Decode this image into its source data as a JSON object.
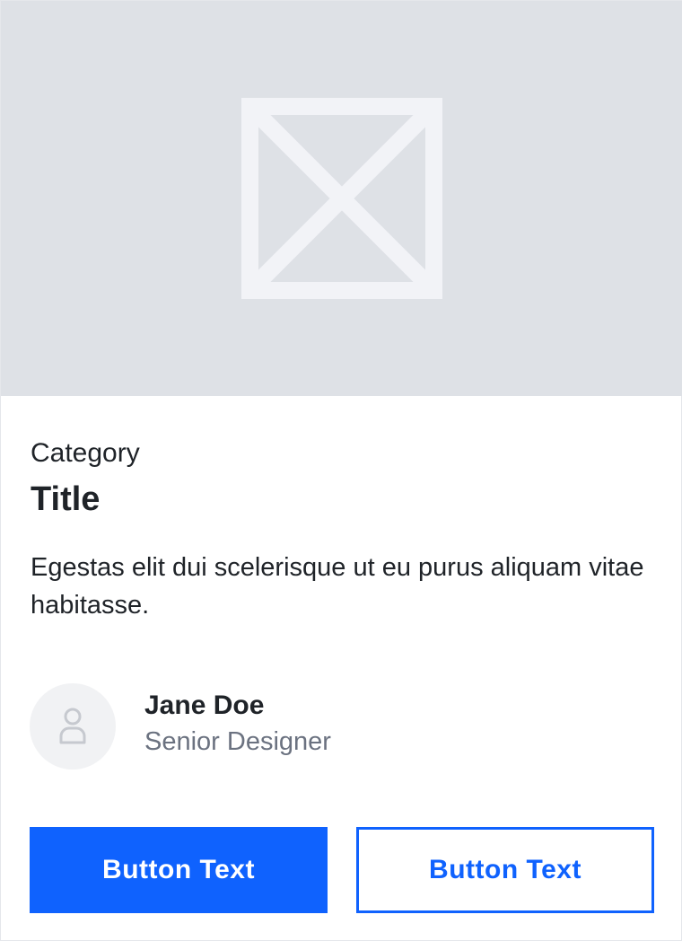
{
  "card": {
    "image": {
      "icon": "image-placeholder-icon",
      "background_color": "#dee1e6",
      "icon_color": "#f2f3f7"
    },
    "category": "Category",
    "title": "Title",
    "description": "Egestas elit dui scelerisque ut eu purus aliquam vitae habitasse.",
    "author": {
      "avatar_icon": "user-icon",
      "name": "Jane Doe",
      "role": "Senior Designer"
    },
    "actions": {
      "primary_label": "Button Text",
      "secondary_label": "Button Text",
      "accent_color": "#0f62fe"
    }
  }
}
